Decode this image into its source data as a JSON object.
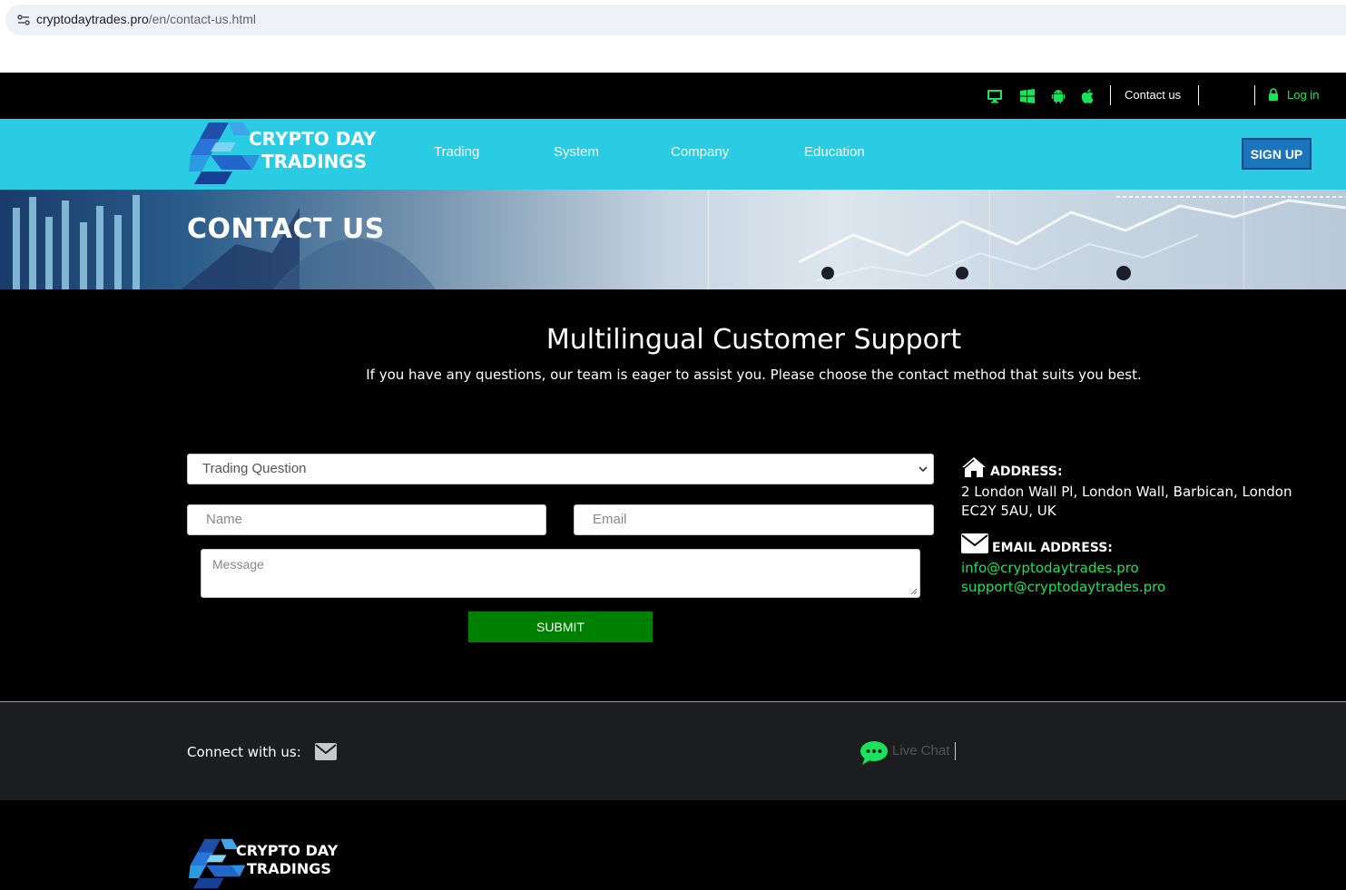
{
  "browser": {
    "url_domain": "cryptodaytrades.pro",
    "url_path": "/en/contact-us.html"
  },
  "topbar": {
    "icons": [
      "desktop-icon",
      "windows-icon",
      "android-icon",
      "apple-icon"
    ],
    "contact_label": "Contact us",
    "login_label": "Log in"
  },
  "nav": {
    "logo_line1": "CRYPTO DAY",
    "logo_line2": "TRADINGS",
    "items": [
      "Trading",
      "System",
      "Company",
      "Education"
    ],
    "signup_label": "SIGN UP"
  },
  "hero": {
    "title": "CONTACT US"
  },
  "main": {
    "heading": "Multilingual Customer Support",
    "subheading": "If you have any questions, our team is eager to assist you. Please choose the contact method that suits you best.",
    "form": {
      "topic_selected": "Trading Question",
      "name_placeholder": "Name",
      "email_placeholder": "Email",
      "message_placeholder": "Message",
      "submit_label": "SUBMIT"
    },
    "address": {
      "label": "ADDRESS:",
      "line1": "2 London Wall Pl, London Wall, Barbican, London",
      "line2": "EC2Y 5AU, UK"
    },
    "email": {
      "label": "EMAIL ADDRESS:",
      "primary": "info@cryptodaytrades.pro",
      "support": "support@cryptodaytrades.pro"
    }
  },
  "connect": {
    "label": "Connect with us:",
    "live_chat": "Live Chat"
  },
  "footer": {
    "logo_line1": "CRYPTO DAY",
    "logo_line2": "TRADINGS"
  },
  "colors": {
    "nav_bg": "#29cce2",
    "accent_green": "#19e35a",
    "submit_green": "#008000",
    "signup_blue": "#1a75ba"
  }
}
